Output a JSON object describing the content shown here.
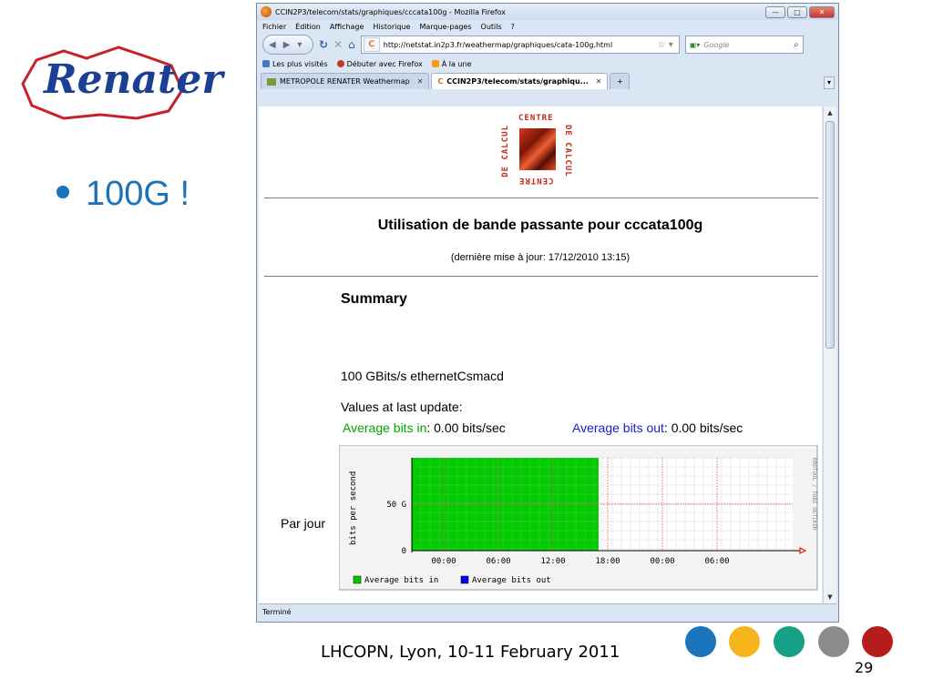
{
  "slide": {
    "logo_text": "Renater",
    "bullet": "100G !",
    "footer": "LHCOPN, Lyon, 10-11 February 2011",
    "page_number": "29",
    "circle_colors": [
      "#1b75bc",
      "#f7b51c",
      "#16a085",
      "#8c8c8c",
      "#b71c1c"
    ]
  },
  "browser": {
    "window_title": "CCIN2P3/telecom/stats/graphiques/cccata100g - Mozilla Firefox",
    "menu": [
      "Fichier",
      "Édition",
      "Affichage",
      "Historique",
      "Marque-pages",
      "Outils",
      "?"
    ],
    "url": "http://netstat.in2p3.fr/weathermap/graphiques/cata-100g.html",
    "search_placeholder": "Google",
    "bookmarks": [
      "Les plus visités",
      "Débuter avec Firefox",
      "À la une"
    ],
    "tabs": [
      {
        "label": "METROPOLE RENATER Weathermap",
        "active": false
      },
      {
        "label": "CCIN2P3/telecom/stats/graphiqu...",
        "active": true
      }
    ],
    "status": "Terminé"
  },
  "page": {
    "logo_top": "CENTRE",
    "logo_left": "DE CALCUL",
    "logo_right": "DE CALCUL",
    "logo_bottom": "CENTRE",
    "title": "Utilisation de bande passante pour cccata100g",
    "update": "(dernière mise à jour: 17/12/2010 13:15)",
    "summary": "Summary",
    "interface": "100 GBits/s ethernetCsmacd",
    "values_label": "Values at last update:",
    "avg_in_label": "Average bits in",
    "avg_in_value": ": 0.00 bits/sec",
    "avg_out_label": "Average bits out",
    "avg_out_value": ": 0.00 bits/sec",
    "row_label": "Par jour"
  },
  "chart_data": {
    "type": "area",
    "ylabel": "bits per second",
    "yticks": [
      {
        "value": 0,
        "label": "0"
      },
      {
        "value": 50,
        "label": "50 G"
      }
    ],
    "ylim": [
      0,
      100
    ],
    "xticks": [
      "00:00",
      "06:00",
      "12:00",
      "18:00",
      "00:00",
      "06:00"
    ],
    "series": [
      {
        "name": "Average bits in",
        "color": "#00cc00",
        "x": [
          "18:00",
          "17:00"
        ],
        "values": [
          100,
          100
        ]
      },
      {
        "name": "Average bits out",
        "color": "#0000ff",
        "x": [
          "18:00",
          "17:00"
        ],
        "values": [
          0,
          0
        ]
      }
    ],
    "side_label": "RRDTOOL / TOBI OETIKER",
    "grid": true
  }
}
